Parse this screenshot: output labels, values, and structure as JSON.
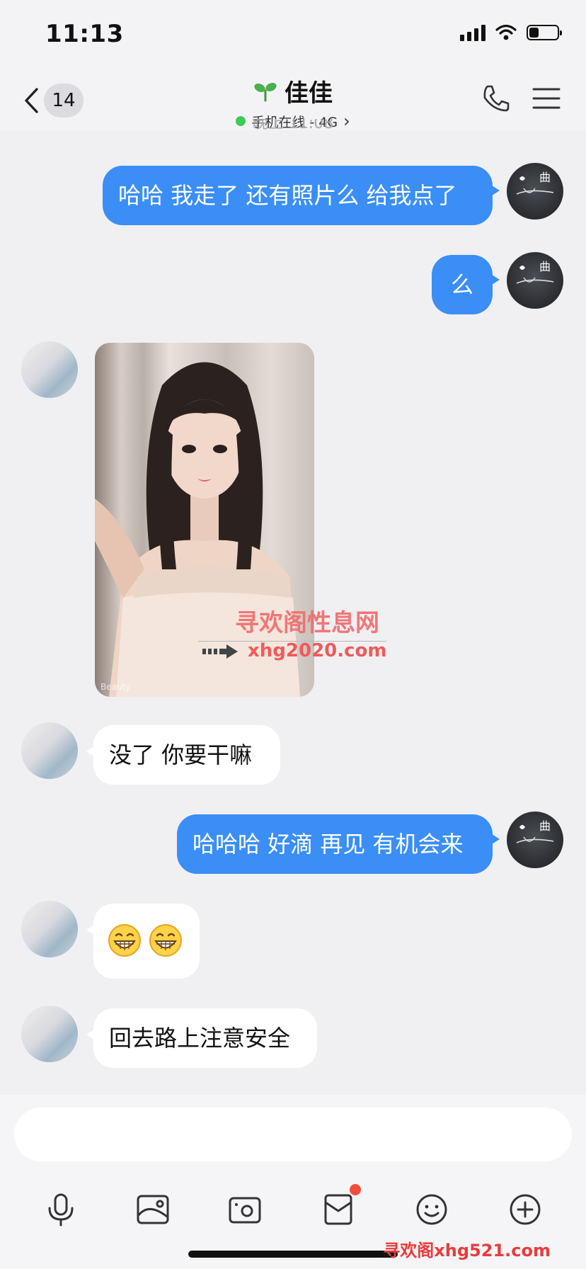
{
  "status_bar": {
    "time": "11:13",
    "battery_level": 0.35
  },
  "nav": {
    "unread_count": "14",
    "contact_name": "佳佳",
    "status_text": "手机在线 - 4G",
    "status_chevron": "›",
    "icons": {
      "back": "chevron-left-icon",
      "name_badge": "sprout-icon",
      "call": "phone-icon",
      "menu": "hamburger-menu-icon"
    }
  },
  "chat": {
    "time_divider": "晚上 11:08",
    "messages": [
      {
        "side": "out",
        "type": "text",
        "text": "哈哈 我走了 还有照片么 给我点了"
      },
      {
        "side": "out",
        "type": "text",
        "text": "么"
      },
      {
        "side": "in",
        "type": "image",
        "caption": "Beauty"
      },
      {
        "side": "in",
        "type": "text",
        "text": "没了 你要干嘛"
      },
      {
        "side": "out",
        "type": "text",
        "text": "哈哈哈 好滴 再见 有机会来"
      },
      {
        "side": "in",
        "type": "emoji",
        "emoji": [
          "grin-face-icon",
          "grin-face-icon"
        ]
      },
      {
        "side": "in",
        "type": "text",
        "text": "回去路上注意安全"
      }
    ]
  },
  "watermarks": {
    "image_title": "寻欢阁性息网",
    "image_url": "xhg2020.com",
    "footer": "寻欢阁xhg521.com"
  },
  "input": {
    "value": "",
    "placeholder": ""
  },
  "toolbar": {
    "icons": [
      "microphone-icon",
      "image-icon",
      "camera-icon",
      "red-packet-icon",
      "emoji-icon",
      "plus-icon"
    ]
  },
  "colors": {
    "outgoing_bubble": "#3a8ef6",
    "incoming_bubble": "#ffffff",
    "background": "#f0f0f2",
    "online_dot": "#3ccb5a",
    "notification_dot": "#f24d3b"
  }
}
